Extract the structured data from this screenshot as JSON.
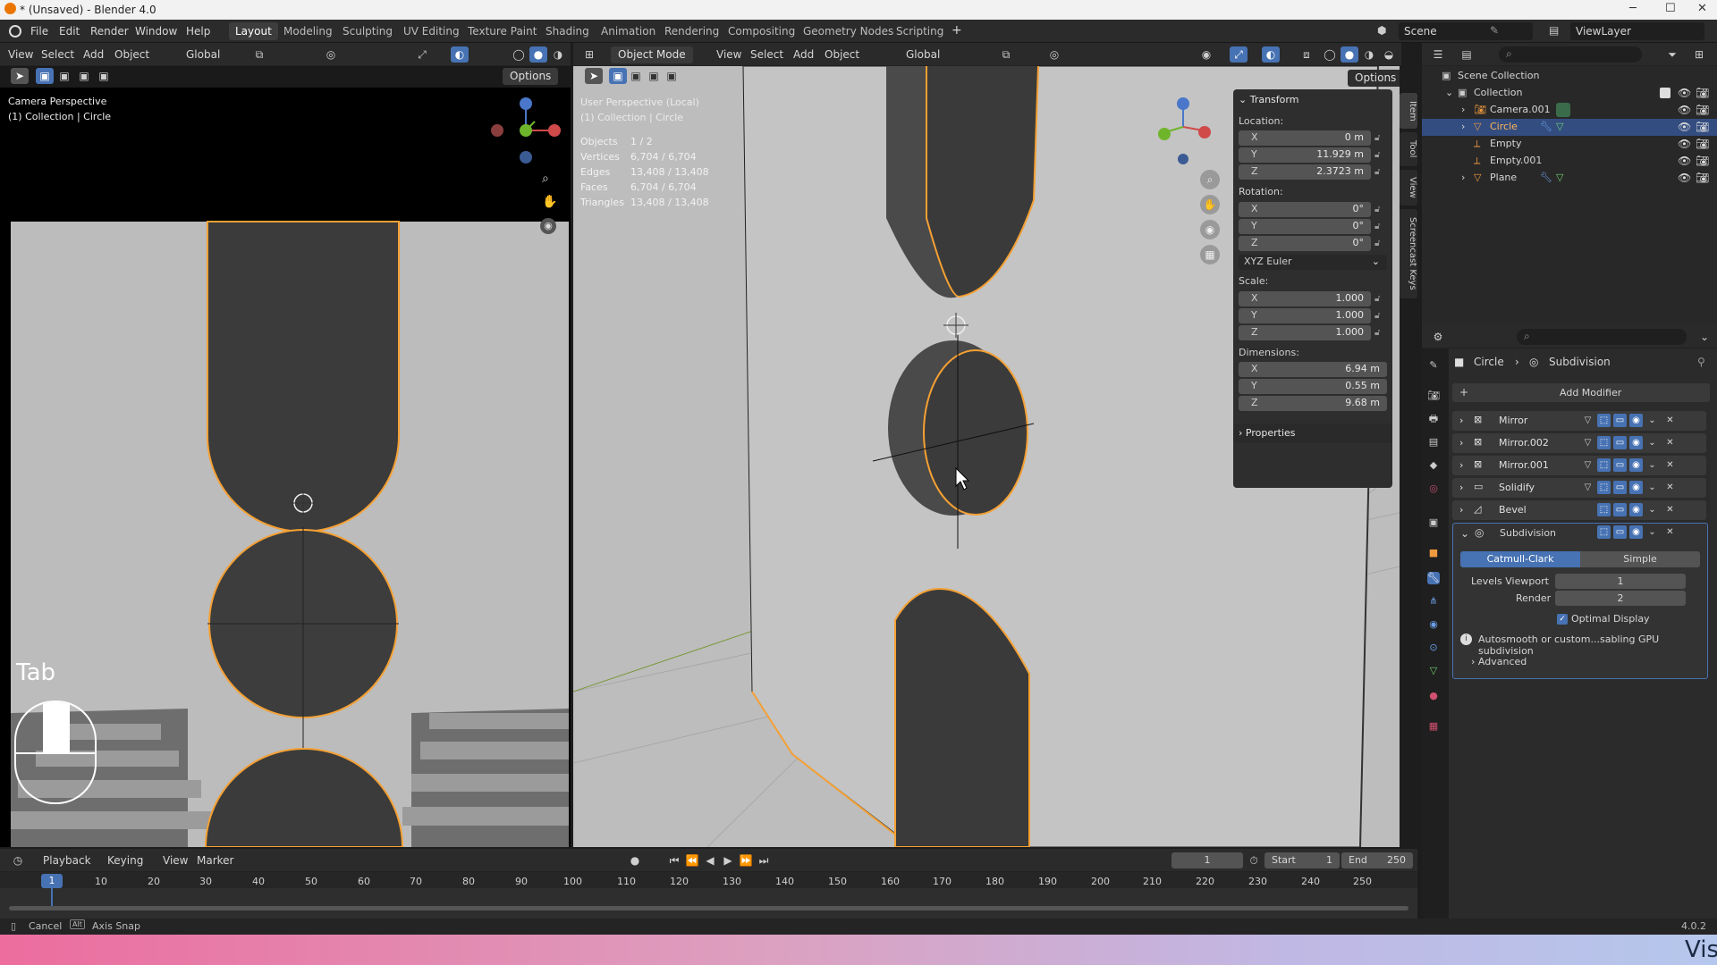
{
  "window": {
    "title": "* (Unsaved) - Blender 4.0"
  },
  "menus": [
    "File",
    "Edit",
    "Render",
    "Window",
    "Help"
  ],
  "workspaces": [
    "Layout",
    "Modeling",
    "Sculpting",
    "UV Editing",
    "Texture Paint",
    "Shading",
    "Animation",
    "Rendering",
    "Compositing",
    "Geometry Nodes",
    "Scripting"
  ],
  "active_workspace": "Layout",
  "scene": {
    "name": "Scene",
    "view_layer": "ViewLayer"
  },
  "left_viewport": {
    "header": {
      "view": "View",
      "select": "Select",
      "add": "Add",
      "object": "Object",
      "orientation": "Global",
      "options": "Options"
    },
    "info_line1": "Camera Perspective",
    "info_line2": "(1) Collection | Circle",
    "key_overlay": "Tab"
  },
  "main_viewport": {
    "header": {
      "mode": "Object Mode",
      "view": "View",
      "select": "Select",
      "add": "Add",
      "object": "Object",
      "orientation": "Global",
      "options": "Options"
    },
    "info_line1": "User Perspective (Local)",
    "info_line2": "(1) Collection | Circle",
    "stats": [
      {
        "label": "Objects",
        "value": "1 / 2"
      },
      {
        "label": "Vertices",
        "value": "6,704 / 6,704"
      },
      {
        "label": "Edges",
        "value": "13,408 / 13,408"
      },
      {
        "label": "Faces",
        "value": "6,704 / 6,704"
      },
      {
        "label": "Triangles",
        "value": "13,408 / 13,408"
      }
    ]
  },
  "transform": {
    "title": "Transform",
    "location_label": "Location:",
    "location": [
      {
        "axis": "X",
        "value": "0 m"
      },
      {
        "axis": "Y",
        "value": "11.929 m"
      },
      {
        "axis": "Z",
        "value": "2.3723 m"
      }
    ],
    "rotation_label": "Rotation:",
    "rotation": [
      {
        "axis": "X",
        "value": "0°"
      },
      {
        "axis": "Y",
        "value": "0°"
      },
      {
        "axis": "Z",
        "value": "0°"
      }
    ],
    "rotation_mode": "XYZ Euler",
    "scale_label": "Scale:",
    "scale": [
      {
        "axis": "X",
        "value": "1.000"
      },
      {
        "axis": "Y",
        "value": "1.000"
      },
      {
        "axis": "Z",
        "value": "1.000"
      }
    ],
    "dimensions_label": "Dimensions:",
    "dimensions": [
      {
        "axis": "X",
        "value": "6.94 m"
      },
      {
        "axis": "Y",
        "value": "0.55 m"
      },
      {
        "axis": "Z",
        "value": "9.68 m"
      }
    ],
    "properties": "Properties"
  },
  "sidebar_tabs": [
    "Item",
    "Tool",
    "View",
    "Screencast Keys"
  ],
  "outliner": {
    "root": "Scene Collection",
    "collection": "Collection",
    "items": [
      {
        "name": "Camera.001",
        "selected": false
      },
      {
        "name": "Circle",
        "selected": true
      },
      {
        "name": "Empty",
        "selected": false
      },
      {
        "name": "Empty.001",
        "selected": false
      },
      {
        "name": "Plane",
        "selected": false
      }
    ]
  },
  "properties_editor": {
    "breadcrumb_object": "Circle",
    "breadcrumb_modifier": "Subdivision",
    "add_modifier": "Add Modifier",
    "modifiers": [
      "Mirror",
      "Mirror.002",
      "Mirror.001",
      "Solidify",
      "Bevel",
      "Subdivision"
    ],
    "subdivision": {
      "mode_a": "Catmull-Clark",
      "mode_b": "Simple",
      "levels_viewport_label": "Levels Viewport",
      "levels_viewport": "1",
      "render_label": "Render",
      "render": "2",
      "optimal_display": "Optimal Display",
      "info": "Autosmooth or custom...sabling GPU subdivision",
      "advanced": "Advanced"
    }
  },
  "timeline": {
    "playback": "Playback",
    "keying": "Keying",
    "view": "View",
    "marker": "Marker",
    "current_frame": "1",
    "start_label": "Start",
    "start": "1",
    "end_label": "End",
    "end": "250",
    "ticks": [
      "1",
      "10",
      "20",
      "30",
      "40",
      "50",
      "60",
      "70",
      "80",
      "90",
      "100",
      "110",
      "120",
      "130",
      "140",
      "150",
      "160",
      "170",
      "180",
      "190",
      "200",
      "210",
      "220",
      "230",
      "240",
      "250"
    ]
  },
  "statusbar": {
    "cancel": "Cancel",
    "alt": "Alt",
    "axis_snap": "Axis Snap",
    "version": "4.0.2"
  },
  "overlay_text": "Visi",
  "colors": {
    "accent": "#4772b3",
    "selection_orange": "#f5a033",
    "banner_left": "#ec6d9e",
    "banner_right": "#b5c7ec"
  }
}
